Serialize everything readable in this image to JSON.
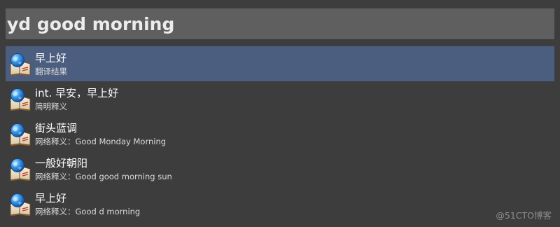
{
  "search": {
    "query": "yd good morning"
  },
  "results": [
    {
      "title": "早上好",
      "subtitle": "翻译结果",
      "icon": "dictionary-globe-icon",
      "selected": true
    },
    {
      "title": "int. 早安，早上好",
      "subtitle": "简明释义",
      "icon": "dictionary-globe-icon",
      "selected": false
    },
    {
      "title": "街头蓝调",
      "subtitle": "网络释义：Good Monday Morning",
      "icon": "dictionary-globe-icon",
      "selected": false
    },
    {
      "title": "一般好朝阳",
      "subtitle": "网络释义：Good good morning sun",
      "icon": "dictionary-globe-icon",
      "selected": false
    },
    {
      "title": "早上好",
      "subtitle": "网络释义：Good d morning",
      "icon": "dictionary-globe-icon",
      "selected": false
    }
  ],
  "watermark": {
    "text": "@51CTO博客"
  },
  "colors": {
    "background": "#3d3d3d",
    "search_bar": "#5f5f5f",
    "selected_row": "#4c5e80"
  }
}
